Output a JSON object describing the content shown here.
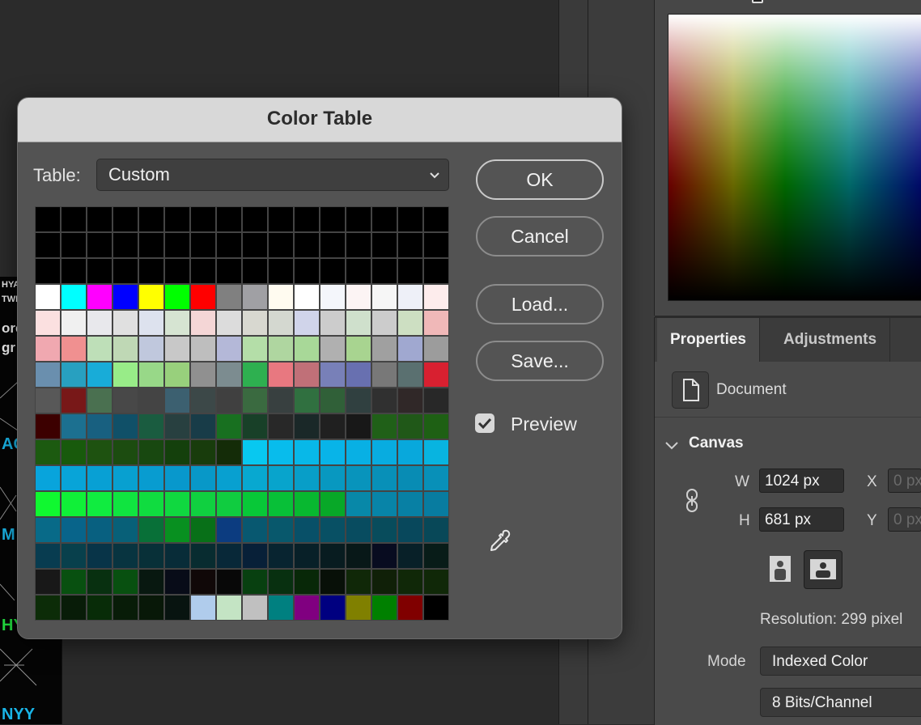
{
  "dialog": {
    "title": "Color Table",
    "table_label": "Table:",
    "table_value": "Custom",
    "buttons": {
      "ok": "OK",
      "cancel": "Cancel",
      "load": "Load...",
      "save": "Save..."
    },
    "preview_label": "Preview",
    "preview_checked": true,
    "swatches": [
      "#000000",
      "#000000",
      "#000000",
      "#000000",
      "#000000",
      "#000000",
      "#000000",
      "#000000",
      "#000000",
      "#000000",
      "#000000",
      "#000000",
      "#000000",
      "#000000",
      "#000000",
      "#000000",
      "#000000",
      "#000000",
      "#000000",
      "#000000",
      "#000000",
      "#000000",
      "#000000",
      "#000000",
      "#000000",
      "#000000",
      "#000000",
      "#000000",
      "#000000",
      "#000000",
      "#000000",
      "#000000",
      "#000000",
      "#000000",
      "#000000",
      "#000000",
      "#000000",
      "#000000",
      "#000000",
      "#000000",
      "#000000",
      "#000000",
      "#000000",
      "#000000",
      "#000000",
      "#000000",
      "#000000",
      "#000000",
      "#ffffff",
      "#00ffff",
      "#ff00ff",
      "#0000ff",
      "#ffff00",
      "#00ff00",
      "#ff0000",
      "#808080",
      "#a0a0a4",
      "#fffbf0",
      "#ffffff",
      "#f4f6fb",
      "#fcf4f4",
      "#f6f6f6",
      "#eef0f8",
      "#fdecec",
      "#fbe0e0",
      "#f0f0f0",
      "#e8e8ec",
      "#e0e0e0",
      "#dde2ee",
      "#d6e4d2",
      "#f4d6d6",
      "#dcdcdc",
      "#d8d8d0",
      "#d4d8d0",
      "#d0d4ea",
      "#cccccc",
      "#cfe0cc",
      "#cccccc",
      "#cddfc2",
      "#f0b8b8",
      "#f0a8b0",
      "#f09090",
      "#bedfb8",
      "#bfd8b5",
      "#c0c8dd",
      "#c8c8c8",
      "#bebebe",
      "#b4b8d8",
      "#b4dea8",
      "#afd6a0",
      "#a8d898",
      "#b0b0b0",
      "#a8d490",
      "#a0a0a0",
      "#a0a8d0",
      "#9c9c9c",
      "#6a8fae",
      "#28a0c0",
      "#18acd8",
      "#98ec88",
      "#98d888",
      "#98d07c",
      "#909090",
      "#7c8c90",
      "#2eb050",
      "#e87880",
      "#c07078",
      "#7880b8",
      "#6870b0",
      "#787878",
      "#5a7070",
      "#d82030",
      "#585858",
      "#781818",
      "#4a7050",
      "#484848",
      "#444444",
      "#3c6070",
      "#3c4848",
      "#404040",
      "#3a6a40",
      "#384040",
      "#307040",
      "#306038",
      "#304040",
      "#303030",
      "#302828",
      "#282828",
      "#3c0000",
      "#1c7090",
      "#186080",
      "#105068",
      "#1a5c40",
      "#284040",
      "#183c48",
      "#187020",
      "#184028",
      "#282828",
      "#1a2828",
      "#202020",
      "#181818",
      "#206018",
      "#205818",
      "#1e6014",
      "#1c5a10",
      "#185a0c",
      "#1e5210",
      "#1c4c10",
      "#184810",
      "#14400c",
      "#183c0c",
      "#142c08",
      "#08c8f0",
      "#08bcec",
      "#08b8e8",
      "#08b4e8",
      "#08b0e4",
      "#08ace0",
      "#08a8dc",
      "#08b4e0",
      "#08a4dc",
      "#08a4d8",
      "#08a0d4",
      "#08a0d0",
      "#089cd0",
      "#0898cc",
      "#0898c8",
      "#08a0d0",
      "#08a8d0",
      "#08a4cc",
      "#089ec8",
      "#0898c0",
      "#0894bc",
      "#0890b8",
      "#088cb4",
      "#0890b8",
      "#10f830",
      "#10f038",
      "#10ec40",
      "#10e440",
      "#10dc40",
      "#10d840",
      "#10d040",
      "#10cc40",
      "#08c838",
      "#08c038",
      "#08b830",
      "#08a828",
      "#0888a8",
      "#0884a8",
      "#0880a4",
      "#087ca0",
      "#086a88",
      "#08648a",
      "#086080",
      "#086078",
      "#087038",
      "#089020",
      "#087018",
      "#0c3c80",
      "#085870",
      "#08586c",
      "#085068",
      "#085064",
      "#084c60",
      "#084c5c",
      "#08485c",
      "#084858",
      "#083c50",
      "#08404c",
      "#083448",
      "#083440",
      "#083038",
      "#082c38",
      "#082c30",
      "#082838",
      "#082038",
      "#082430",
      "#082028",
      "#081c20",
      "#081818",
      "#080c20",
      "#082028",
      "#081c18",
      "#181818",
      "#085010",
      "#083010",
      "#085010",
      "#081810",
      "#080c18",
      "#100808",
      "#080808",
      "#084010",
      "#083010",
      "#082808",
      "#081008",
      "#102808",
      "#102008",
      "#102808",
      "#102808",
      "#0c2c08",
      "#081c08",
      "#082c08",
      "#081c08",
      "#081808",
      "#081410",
      "#b0ccec",
      "#c4e4c4",
      "#c0c0c0",
      "#008080",
      "#800080",
      "#000080",
      "#808000",
      "#008000",
      "#800000",
      "#000000"
    ]
  },
  "picker": {
    "gradient_colors": [
      "#ff0000",
      "#ffff00",
      "#00ff00",
      "#00ffff",
      "#0000ff"
    ]
  },
  "properties": {
    "tabs": [
      "Properties",
      "Adjustments"
    ],
    "document_label": "Document",
    "canvas_section": "Canvas",
    "w_label": "W",
    "w_value": "1024 px",
    "h_label": "H",
    "h_value": "681 px",
    "x_label": "X",
    "x_value": "0 px",
    "y_label": "Y",
    "y_value": "0 px",
    "resolution": "Resolution: 299 pixel",
    "mode_label": "Mode",
    "mode_value": "Indexed Color",
    "depth_value": "8 Bits/Channel"
  },
  "document_fragments": [
    "HYA",
    "TWI",
    "ore",
    "gr",
    "AC",
    "M",
    "HY",
    "NYY"
  ]
}
